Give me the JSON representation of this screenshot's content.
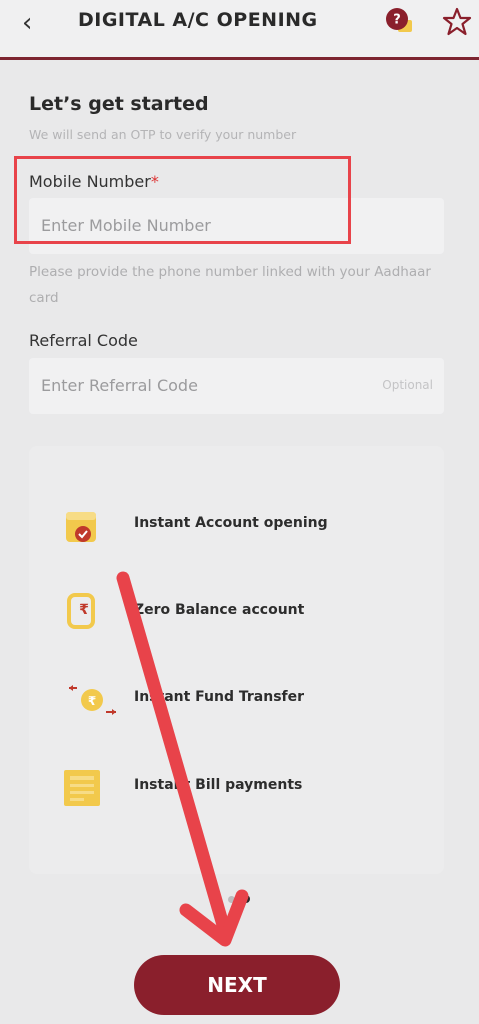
{
  "header": {
    "title": "DIGITAL A/C OPENING",
    "icons": [
      "back-chevron-icon",
      "help-icon",
      "star-icon"
    ]
  },
  "intro": {
    "heading": "Let’s get started",
    "subtitle": "We will send an OTP to verify your number"
  },
  "mobile": {
    "label": "Mobile Number",
    "required_mark": "*",
    "placeholder": "Enter Mobile Number",
    "hint": "Please provide the phone number linked with your Aadhaar card"
  },
  "referral": {
    "label": "Referral Code",
    "placeholder": "Enter Referral Code",
    "optional": "Optional"
  },
  "features": [
    {
      "label": "Instant Account opening",
      "icon": "account-badge-icon"
    },
    {
      "label": "Zero Balance account",
      "icon": "rupee-wallet-icon"
    },
    {
      "label": "Instant Fund Transfer",
      "icon": "fund-transfer-icon"
    },
    {
      "label": "Instant Bill payments",
      "icon": "bill-icon"
    }
  ],
  "pager": {
    "active_index": 1,
    "count": 2
  },
  "next_label": "NEXT",
  "colors": {
    "brand": "#8a1f2c",
    "annotation": "#e8434a",
    "icon_accent": "#f2c94c"
  }
}
